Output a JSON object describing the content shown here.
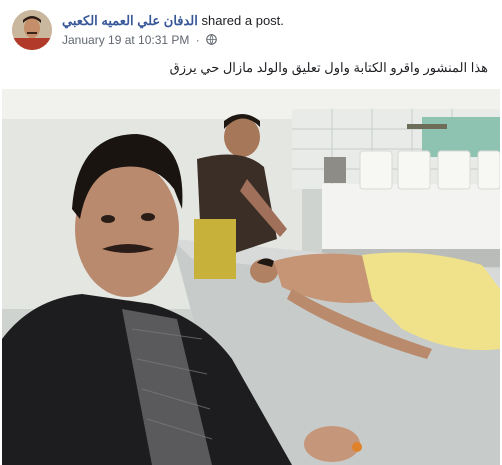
{
  "post": {
    "author": "الدفان علي العميه الكعبي",
    "action": "shared a post.",
    "timestamp": "January 19 at 10:31 PM",
    "separator": "·",
    "privacy_icon": "globe-icon",
    "text": "هذا المنشور واقرو الكتابة واول تعليق والولد مازال حي يرزق"
  },
  "colors": {
    "author_link": "#385898",
    "meta_text": "#616770",
    "body_text": "#1c1e21"
  }
}
